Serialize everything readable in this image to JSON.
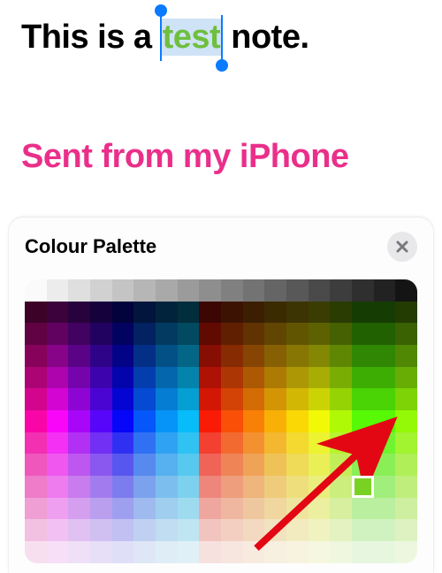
{
  "note": {
    "prefix": "This is a ",
    "selected_word": "test",
    "suffix": " note.",
    "selected_color": "#6fbf3f",
    "selection_bg": "#cfe3f7",
    "caret_color": "#0a7aff"
  },
  "signature": {
    "text": "Sent from my iPhone",
    "color": "#ea2f8a"
  },
  "panel": {
    "title": "Colour Palette"
  },
  "palette": {
    "cols": 18,
    "rows": 13,
    "base_hues": [
      0,
      20,
      35,
      48,
      60,
      75,
      100,
      140,
      175,
      195,
      210,
      230,
      255,
      275,
      295,
      320
    ],
    "selected": {
      "row": 9,
      "col": 15,
      "hex": "#79d222"
    }
  },
  "annotation": {
    "arrow_color": "#e30613"
  }
}
